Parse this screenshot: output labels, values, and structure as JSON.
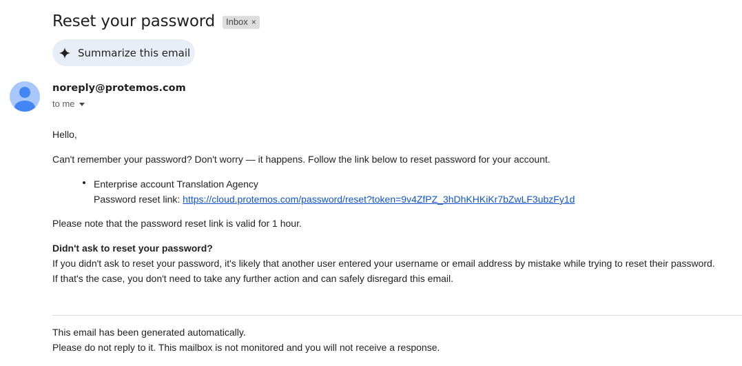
{
  "header": {
    "subject": "Reset your password",
    "label": "Inbox",
    "label_remove": "×"
  },
  "summarize": {
    "label": "Summarize this email"
  },
  "sender": {
    "email": "noreply@protemos.com",
    "recipient": "to me"
  },
  "message": {
    "greeting": "Hello,",
    "intro": "Can't remember your password? Don't worry — it happens. Follow the link below to reset password for your account.",
    "account_line": "Enterprise account Translation Agency",
    "reset_link_label": "Password reset link: ",
    "reset_link_url": "https://cloud.protemos.com/password/reset?token=9v4ZfPZ_3hDhKHKiKr7bZwLF3ubzFy1d",
    "validity_note": "Please note that the password reset link is valid for 1 hour.",
    "didnt_ask_heading": "Didn't ask to reset your password?",
    "didnt_ask_line1": "If you didn't ask to reset your password, it's likely that another user entered your username or email address by mistake while trying to reset their password.",
    "didnt_ask_line2": "If that's the case, you don't need to take any further action and can safely disregard this email.",
    "footer_line1": "This email has been generated automatically.",
    "footer_line2": "Please do not reply to it. This mailbox is not monitored and you will not receive a response."
  },
  "colors": {
    "avatar_bg": "#a8c7fa",
    "avatar_fg": "#4285f4",
    "summarize_bg": "#e9eef6",
    "link": "#1155cc"
  },
  "icons": {
    "summarize": "sparkle-icon",
    "avatar": "person-icon",
    "recipient_toggle": "caret-down-icon",
    "label_remove": "close-icon"
  }
}
